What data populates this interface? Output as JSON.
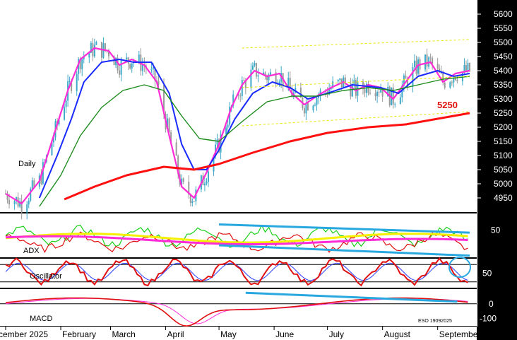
{
  "chart_data": {
    "type": "line",
    "timeframe_label": "Daily",
    "stamp": "ESO 19092025",
    "colors": {
      "background": "#000000",
      "panel_bg": "#ffffff",
      "axis_text": "#ffffff",
      "bull_candle": "#3fa9c9",
      "bear_candle": "#9a9a9a",
      "ma_fast": "#ff2bd6",
      "ma_mid": "#1a2bff",
      "ma_slow": "#1c8c1c",
      "ma_long": "#ff1010",
      "channel": "#e6e600",
      "trendline": "#29a8e0",
      "highlight_circle": "#29a8e0"
    },
    "x_axis": {
      "ticks": [
        {
          "label": "cember 2025",
          "date": "2025-01-01"
        },
        {
          "label": "February",
          "date": "2025-02-01"
        },
        {
          "label": "March",
          "date": "2025-03-01"
        },
        {
          "label": "April",
          "date": "2025-04-01"
        },
        {
          "label": "May",
          "date": "2025-05-01"
        },
        {
          "label": "June",
          "date": "2025-06-01"
        },
        {
          "label": "July",
          "date": "2025-07-01"
        },
        {
          "label": "August",
          "date": "2025-08-01"
        },
        {
          "label": "September",
          "date": "2025-09-01"
        }
      ],
      "start": "2025-01-01",
      "end": "2025-09-19"
    },
    "price_panel": {
      "ylim": [
        4900,
        5650
      ],
      "yticks": [
        4950,
        5000,
        5050,
        5100,
        5150,
        5200,
        5250,
        5300,
        5350,
        5400,
        5450,
        5500,
        5550,
        5600
      ],
      "annotation": {
        "text": "5250",
        "value": 5250
      },
      "series": [
        {
          "key": "ma_fast",
          "points": [
            [
              "2025-01-01",
              4965
            ],
            [
              "2025-01-10",
              4930
            ],
            [
              "2025-01-20",
              5010
            ],
            [
              "2025-01-30",
              5210
            ],
            [
              "2025-02-05",
              5330
            ],
            [
              "2025-02-12",
              5440
            ],
            [
              "2025-02-20",
              5480
            ],
            [
              "2025-02-28",
              5470
            ],
            [
              "2025-03-06",
              5420
            ],
            [
              "2025-03-13",
              5440
            ],
            [
              "2025-03-20",
              5420
            ],
            [
              "2025-03-27",
              5360
            ],
            [
              "2025-04-03",
              5170
            ],
            [
              "2025-04-10",
              4990
            ],
            [
              "2025-04-17",
              4950
            ],
            [
              "2025-04-24",
              5040
            ],
            [
              "2025-05-01",
              5140
            ],
            [
              "2025-05-08",
              5270
            ],
            [
              "2025-05-14",
              5350
            ],
            [
              "2025-05-21",
              5400
            ],
            [
              "2025-05-28",
              5380
            ],
            [
              "2025-06-04",
              5390
            ],
            [
              "2025-06-11",
              5320
            ],
            [
              "2025-06-18",
              5280
            ],
            [
              "2025-06-25",
              5310
            ],
            [
              "2025-07-03",
              5340
            ],
            [
              "2025-07-10",
              5360
            ],
            [
              "2025-07-17",
              5330
            ],
            [
              "2025-07-24",
              5350
            ],
            [
              "2025-07-31",
              5340
            ],
            [
              "2025-08-07",
              5300
            ],
            [
              "2025-08-14",
              5360
            ],
            [
              "2025-08-21",
              5420
            ],
            [
              "2025-08-28",
              5430
            ],
            [
              "2025-09-04",
              5360
            ],
            [
              "2025-09-11",
              5390
            ],
            [
              "2025-09-19",
              5400
            ]
          ]
        },
        {
          "key": "ma_mid",
          "points": [
            [
              "2025-01-20",
              4950
            ],
            [
              "2025-01-30",
              5100
            ],
            [
              "2025-02-07",
              5230
            ],
            [
              "2025-02-14",
              5360
            ],
            [
              "2025-02-24",
              5430
            ],
            [
              "2025-03-06",
              5440
            ],
            [
              "2025-03-14",
              5430
            ],
            [
              "2025-03-24",
              5430
            ],
            [
              "2025-04-03",
              5320
            ],
            [
              "2025-04-10",
              5140
            ],
            [
              "2025-04-17",
              5050
            ],
            [
              "2025-04-24",
              5050
            ],
            [
              "2025-05-01",
              5120
            ],
            [
              "2025-05-10",
              5230
            ],
            [
              "2025-05-20",
              5320
            ],
            [
              "2025-05-31",
              5360
            ],
            [
              "2025-06-10",
              5340
            ],
            [
              "2025-06-20",
              5300
            ],
            [
              "2025-07-01",
              5320
            ],
            [
              "2025-07-15",
              5350
            ],
            [
              "2025-07-31",
              5340
            ],
            [
              "2025-08-10",
              5320
            ],
            [
              "2025-08-21",
              5380
            ],
            [
              "2025-09-01",
              5400
            ],
            [
              "2025-09-10",
              5380
            ],
            [
              "2025-09-19",
              5390
            ]
          ]
        },
        {
          "key": "ma_slow",
          "points": [
            [
              "2025-01-20",
              4920
            ],
            [
              "2025-02-01",
              5030
            ],
            [
              "2025-02-12",
              5170
            ],
            [
              "2025-02-24",
              5270
            ],
            [
              "2025-03-08",
              5330
            ],
            [
              "2025-03-20",
              5350
            ],
            [
              "2025-03-31",
              5330
            ],
            [
              "2025-04-10",
              5240
            ],
            [
              "2025-04-20",
              5160
            ],
            [
              "2025-05-01",
              5150
            ],
            [
              "2025-05-14",
              5220
            ],
            [
              "2025-05-28",
              5290
            ],
            [
              "2025-06-11",
              5310
            ],
            [
              "2025-06-25",
              5310
            ],
            [
              "2025-07-10",
              5330
            ],
            [
              "2025-07-24",
              5340
            ],
            [
              "2025-08-07",
              5330
            ],
            [
              "2025-08-21",
              5350
            ],
            [
              "2025-09-04",
              5370
            ],
            [
              "2025-09-19",
              5380
            ]
          ]
        },
        {
          "key": "ma_long",
          "points": [
            [
              "2025-02-03",
              4945
            ],
            [
              "2025-02-20",
              4990
            ],
            [
              "2025-03-10",
              5030
            ],
            [
              "2025-03-31",
              5060
            ],
            [
              "2025-04-17",
              5050
            ],
            [
              "2025-05-01",
              5070
            ],
            [
              "2025-05-20",
              5110
            ],
            [
              "2025-06-10",
              5150
            ],
            [
              "2025-07-01",
              5180
            ],
            [
              "2025-07-24",
              5200
            ],
            [
              "2025-08-14",
              5210
            ],
            [
              "2025-09-01",
              5230
            ],
            [
              "2025-09-19",
              5250
            ]
          ]
        }
      ],
      "channel": {
        "upper": [
          [
            "2025-05-14",
            5480
          ],
          [
            "2025-09-19",
            5510
          ]
        ],
        "middle": [
          [
            "2025-05-14",
            5340
          ],
          [
            "2025-09-19",
            5380
          ]
        ],
        "lower": [
          [
            "2025-05-14",
            5205
          ],
          [
            "2025-09-19",
            5255
          ]
        ]
      }
    },
    "adx_panel": {
      "label": "ADX",
      "yticks": [
        50
      ],
      "ylim": [
        0,
        80
      ],
      "trend_upper": [
        [
          "2025-05-01",
          60
        ],
        [
          "2025-09-19",
          45
        ]
      ],
      "trend_lower": [
        [
          "2025-05-01",
          22
        ],
        [
          "2025-09-19",
          3
        ]
      ]
    },
    "oscillator_panel": {
      "label": "Oscillator",
      "yticks": [
        50
      ],
      "ylim": [
        0,
        100
      ],
      "levels": [
        80,
        20
      ]
    },
    "macd_panel": {
      "label": "MACD",
      "yticks": [
        0,
        -100
      ],
      "ylim": [
        -150,
        100
      ],
      "trendline": [
        [
          "2025-05-16",
          75
        ],
        [
          "2025-09-12",
          15
        ]
      ]
    }
  }
}
